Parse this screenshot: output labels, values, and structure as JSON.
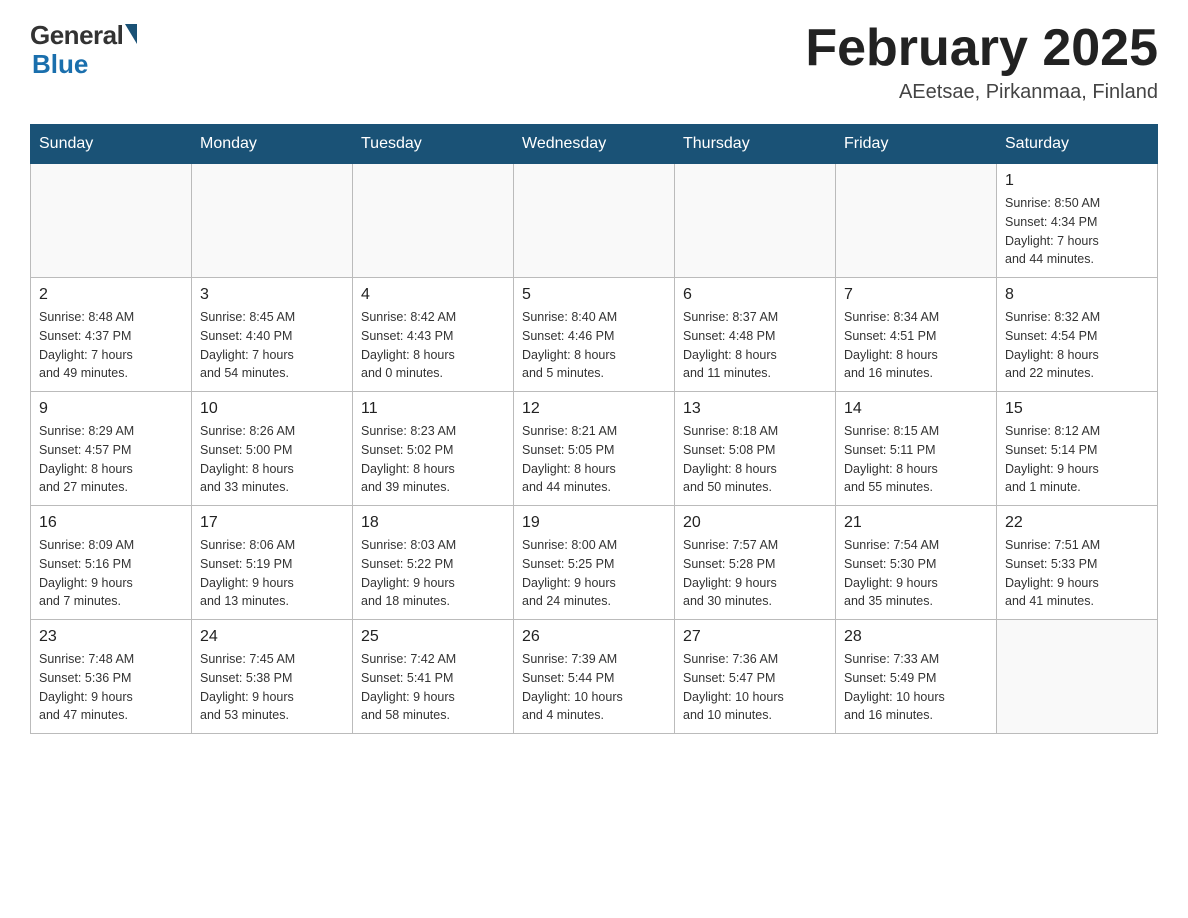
{
  "header": {
    "logo_general": "General",
    "logo_blue": "Blue",
    "month_title": "February 2025",
    "location": "AEetsae, Pirkanmaa, Finland"
  },
  "weekdays": [
    "Sunday",
    "Monday",
    "Tuesday",
    "Wednesday",
    "Thursday",
    "Friday",
    "Saturday"
  ],
  "weeks": [
    [
      {
        "day": "",
        "info": ""
      },
      {
        "day": "",
        "info": ""
      },
      {
        "day": "",
        "info": ""
      },
      {
        "day": "",
        "info": ""
      },
      {
        "day": "",
        "info": ""
      },
      {
        "day": "",
        "info": ""
      },
      {
        "day": "1",
        "info": "Sunrise: 8:50 AM\nSunset: 4:34 PM\nDaylight: 7 hours\nand 44 minutes."
      }
    ],
    [
      {
        "day": "2",
        "info": "Sunrise: 8:48 AM\nSunset: 4:37 PM\nDaylight: 7 hours\nand 49 minutes."
      },
      {
        "day": "3",
        "info": "Sunrise: 8:45 AM\nSunset: 4:40 PM\nDaylight: 7 hours\nand 54 minutes."
      },
      {
        "day": "4",
        "info": "Sunrise: 8:42 AM\nSunset: 4:43 PM\nDaylight: 8 hours\nand 0 minutes."
      },
      {
        "day": "5",
        "info": "Sunrise: 8:40 AM\nSunset: 4:46 PM\nDaylight: 8 hours\nand 5 minutes."
      },
      {
        "day": "6",
        "info": "Sunrise: 8:37 AM\nSunset: 4:48 PM\nDaylight: 8 hours\nand 11 minutes."
      },
      {
        "day": "7",
        "info": "Sunrise: 8:34 AM\nSunset: 4:51 PM\nDaylight: 8 hours\nand 16 minutes."
      },
      {
        "day": "8",
        "info": "Sunrise: 8:32 AM\nSunset: 4:54 PM\nDaylight: 8 hours\nand 22 minutes."
      }
    ],
    [
      {
        "day": "9",
        "info": "Sunrise: 8:29 AM\nSunset: 4:57 PM\nDaylight: 8 hours\nand 27 minutes."
      },
      {
        "day": "10",
        "info": "Sunrise: 8:26 AM\nSunset: 5:00 PM\nDaylight: 8 hours\nand 33 minutes."
      },
      {
        "day": "11",
        "info": "Sunrise: 8:23 AM\nSunset: 5:02 PM\nDaylight: 8 hours\nand 39 minutes."
      },
      {
        "day": "12",
        "info": "Sunrise: 8:21 AM\nSunset: 5:05 PM\nDaylight: 8 hours\nand 44 minutes."
      },
      {
        "day": "13",
        "info": "Sunrise: 8:18 AM\nSunset: 5:08 PM\nDaylight: 8 hours\nand 50 minutes."
      },
      {
        "day": "14",
        "info": "Sunrise: 8:15 AM\nSunset: 5:11 PM\nDaylight: 8 hours\nand 55 minutes."
      },
      {
        "day": "15",
        "info": "Sunrise: 8:12 AM\nSunset: 5:14 PM\nDaylight: 9 hours\nand 1 minute."
      }
    ],
    [
      {
        "day": "16",
        "info": "Sunrise: 8:09 AM\nSunset: 5:16 PM\nDaylight: 9 hours\nand 7 minutes."
      },
      {
        "day": "17",
        "info": "Sunrise: 8:06 AM\nSunset: 5:19 PM\nDaylight: 9 hours\nand 13 minutes."
      },
      {
        "day": "18",
        "info": "Sunrise: 8:03 AM\nSunset: 5:22 PM\nDaylight: 9 hours\nand 18 minutes."
      },
      {
        "day": "19",
        "info": "Sunrise: 8:00 AM\nSunset: 5:25 PM\nDaylight: 9 hours\nand 24 minutes."
      },
      {
        "day": "20",
        "info": "Sunrise: 7:57 AM\nSunset: 5:28 PM\nDaylight: 9 hours\nand 30 minutes."
      },
      {
        "day": "21",
        "info": "Sunrise: 7:54 AM\nSunset: 5:30 PM\nDaylight: 9 hours\nand 35 minutes."
      },
      {
        "day": "22",
        "info": "Sunrise: 7:51 AM\nSunset: 5:33 PM\nDaylight: 9 hours\nand 41 minutes."
      }
    ],
    [
      {
        "day": "23",
        "info": "Sunrise: 7:48 AM\nSunset: 5:36 PM\nDaylight: 9 hours\nand 47 minutes."
      },
      {
        "day": "24",
        "info": "Sunrise: 7:45 AM\nSunset: 5:38 PM\nDaylight: 9 hours\nand 53 minutes."
      },
      {
        "day": "25",
        "info": "Sunrise: 7:42 AM\nSunset: 5:41 PM\nDaylight: 9 hours\nand 58 minutes."
      },
      {
        "day": "26",
        "info": "Sunrise: 7:39 AM\nSunset: 5:44 PM\nDaylight: 10 hours\nand 4 minutes."
      },
      {
        "day": "27",
        "info": "Sunrise: 7:36 AM\nSunset: 5:47 PM\nDaylight: 10 hours\nand 10 minutes."
      },
      {
        "day": "28",
        "info": "Sunrise: 7:33 AM\nSunset: 5:49 PM\nDaylight: 10 hours\nand 16 minutes."
      },
      {
        "day": "",
        "info": ""
      }
    ]
  ]
}
